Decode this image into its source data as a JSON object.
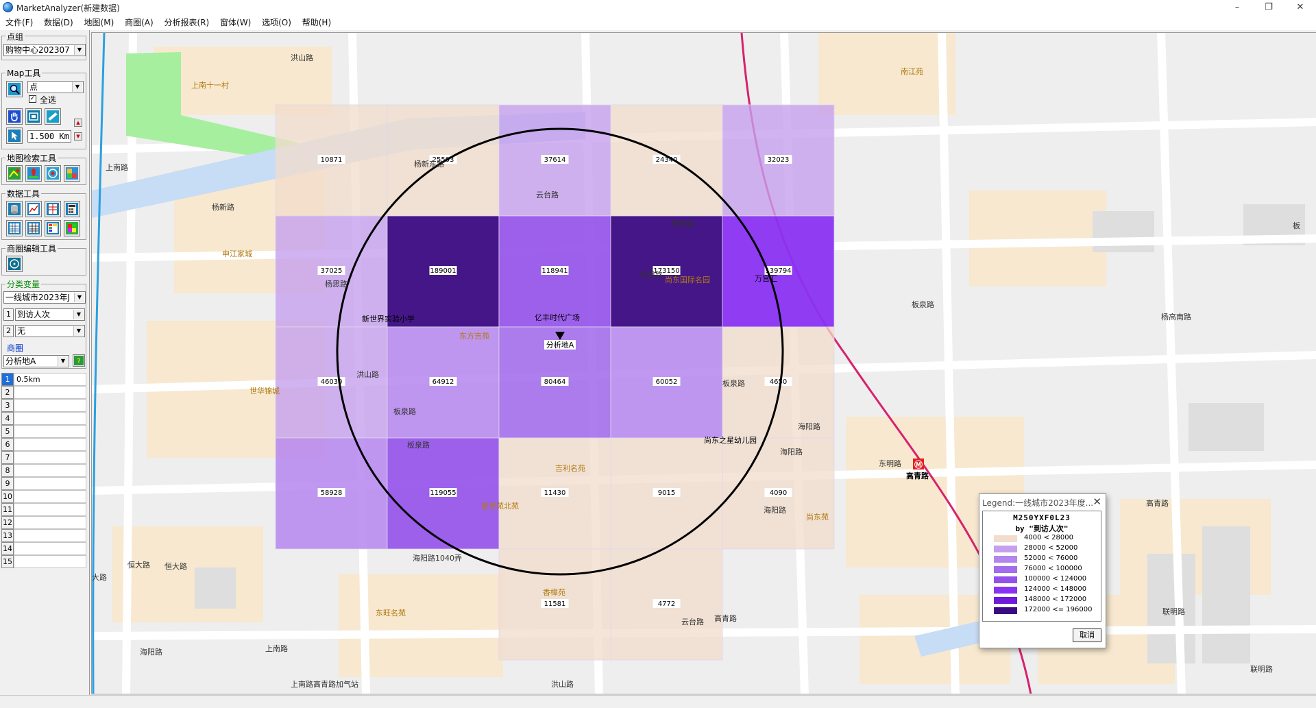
{
  "window": {
    "title": "MarketAnalyzer(新建数据)",
    "min": "–",
    "max": "❐",
    "close": "✕"
  },
  "menu": [
    "文件(F)",
    "数据(D)",
    "地图(M)",
    "商圈(A)",
    "分析报表(R)",
    "窗体(W)",
    "选项(O)",
    "帮助(H)"
  ],
  "panel": {
    "point_group_label": "点组",
    "point_group_value": "购物中心202307",
    "map_tools_label": "Map工具",
    "map_tools_select": "点",
    "select_all_label": "全选",
    "select_all_checked": true,
    "distance_value": "1.500 Km",
    "map_search_label": "地图检索工具",
    "data_tools_label": "数据工具",
    "ring_edit_label": "商圈编辑工具",
    "classvar_label": "分类变量",
    "classvar_value": "一线城市2023年J",
    "var1_index": "1",
    "var1_value": "到访人次",
    "var2_index": "2",
    "var2_value": "无",
    "ring_label": "商圈",
    "ring_select": "分析地A",
    "ring_rows": [
      {
        "n": "1",
        "v": "0.5km"
      },
      {
        "n": "2",
        "v": ""
      },
      {
        "n": "3",
        "v": ""
      },
      {
        "n": "4",
        "v": ""
      },
      {
        "n": "5",
        "v": ""
      },
      {
        "n": "6",
        "v": ""
      },
      {
        "n": "7",
        "v": ""
      },
      {
        "n": "8",
        "v": ""
      },
      {
        "n": "9",
        "v": ""
      },
      {
        "n": "10",
        "v": ""
      },
      {
        "n": "11",
        "v": ""
      },
      {
        "n": "12",
        "v": ""
      },
      {
        "n": "13",
        "v": ""
      },
      {
        "n": "14",
        "v": ""
      },
      {
        "n": "15",
        "v": ""
      }
    ]
  },
  "map": {
    "cells": [
      {
        "c": 0,
        "r": 0,
        "v": 10871
      },
      {
        "c": 1,
        "r": 0,
        "v": 25503
      },
      {
        "c": 2,
        "r": 0,
        "v": 37614
      },
      {
        "c": 3,
        "r": 0,
        "v": 24340
      },
      {
        "c": 4,
        "r": 0,
        "v": 32023
      },
      {
        "c": 0,
        "r": 1,
        "v": 37025
      },
      {
        "c": 1,
        "r": 1,
        "v": 189001
      },
      {
        "c": 2,
        "r": 1,
        "v": 118941
      },
      {
        "c": 3,
        "r": 1,
        "v": 173150
      },
      {
        "c": 4,
        "r": 1,
        "v": 139794
      },
      {
        "c": 0,
        "r": 2,
        "v": 46030
      },
      {
        "c": 1,
        "r": 2,
        "v": 64912
      },
      {
        "c": 2,
        "r": 2,
        "v": 80464
      },
      {
        "c": 3,
        "r": 2,
        "v": 60052
      },
      {
        "c": 4,
        "r": 2,
        "v": 4650
      },
      {
        "c": 0,
        "r": 3,
        "v": 58928
      },
      {
        "c": 1,
        "r": 3,
        "v": 119055
      },
      {
        "c": 2,
        "r": 3,
        "v": 11430
      },
      {
        "c": 3,
        "r": 3,
        "v": 9015
      },
      {
        "c": 4,
        "r": 3,
        "v": 4090
      },
      {
        "c": 2,
        "r": 4,
        "v": 11581
      },
      {
        "c": 3,
        "r": 4,
        "v": 4772
      }
    ],
    "center_label": "分析地A",
    "road_labels": [
      "洪山路",
      "上南路",
      "杨新东路",
      "杨新路",
      "云台路",
      "杨思路",
      "板泉路",
      "杨高南路",
      "洪山路",
      "板泉路",
      "海阳路",
      "东明路",
      "高青路",
      "恒大路",
      "恒大路",
      "大路",
      "海阳路",
      "上南路",
      "海阳路1040弄",
      "云台路",
      "高青路",
      "联明路",
      "联明路",
      "洪山路",
      "上南路高青路加气站",
      "板"
    ],
    "places": [
      "上南十一村",
      "南江苑",
      "申江家城",
      "世华锦城",
      "东方吉苑",
      "尚东国际名园",
      "吉利名苑",
      "盛世苑北苑",
      "尚东苑",
      "香樟苑",
      "东旺名苑"
    ],
    "pois": [
      "新世界实验小学",
      "亿丰时代广场",
      "万宫汇",
      "尚东之星幼儿园"
    ],
    "metro_station": "高青路",
    "metro_icon": "Ⓜ",
    "colors": {
      "c1": "#f2dccb",
      "c2": "#c6a0ee",
      "c3": "#b585ee",
      "c4": "#a36cec",
      "c5": "#9350ea",
      "c6": "#8a32f2",
      "c7": "#6d1ad9",
      "c8": "#3b0a82"
    }
  },
  "legend": {
    "window_title": "Legend:一线城市2023年度...",
    "close": "✕",
    "heading1": "M250YXF0L23",
    "heading2": "by \"到访人次\"",
    "rows": [
      {
        "text": "4000  <  28000",
        "color": "#f2dccb"
      },
      {
        "text": "28000  <  52000",
        "color": "#c6a0ee"
      },
      {
        "text": "52000  <  76000",
        "color": "#b585ee"
      },
      {
        "text": "76000  <  100000",
        "color": "#a36cec"
      },
      {
        "text": "100000  <  124000",
        "color": "#9350ea"
      },
      {
        "text": "124000  <  148000",
        "color": "#8a32f2"
      },
      {
        "text": "148000  <  172000",
        "color": "#6d1ad9"
      },
      {
        "text": "172000  <= 196000",
        "color": "#3b0a82"
      }
    ],
    "cancel": "取消"
  }
}
